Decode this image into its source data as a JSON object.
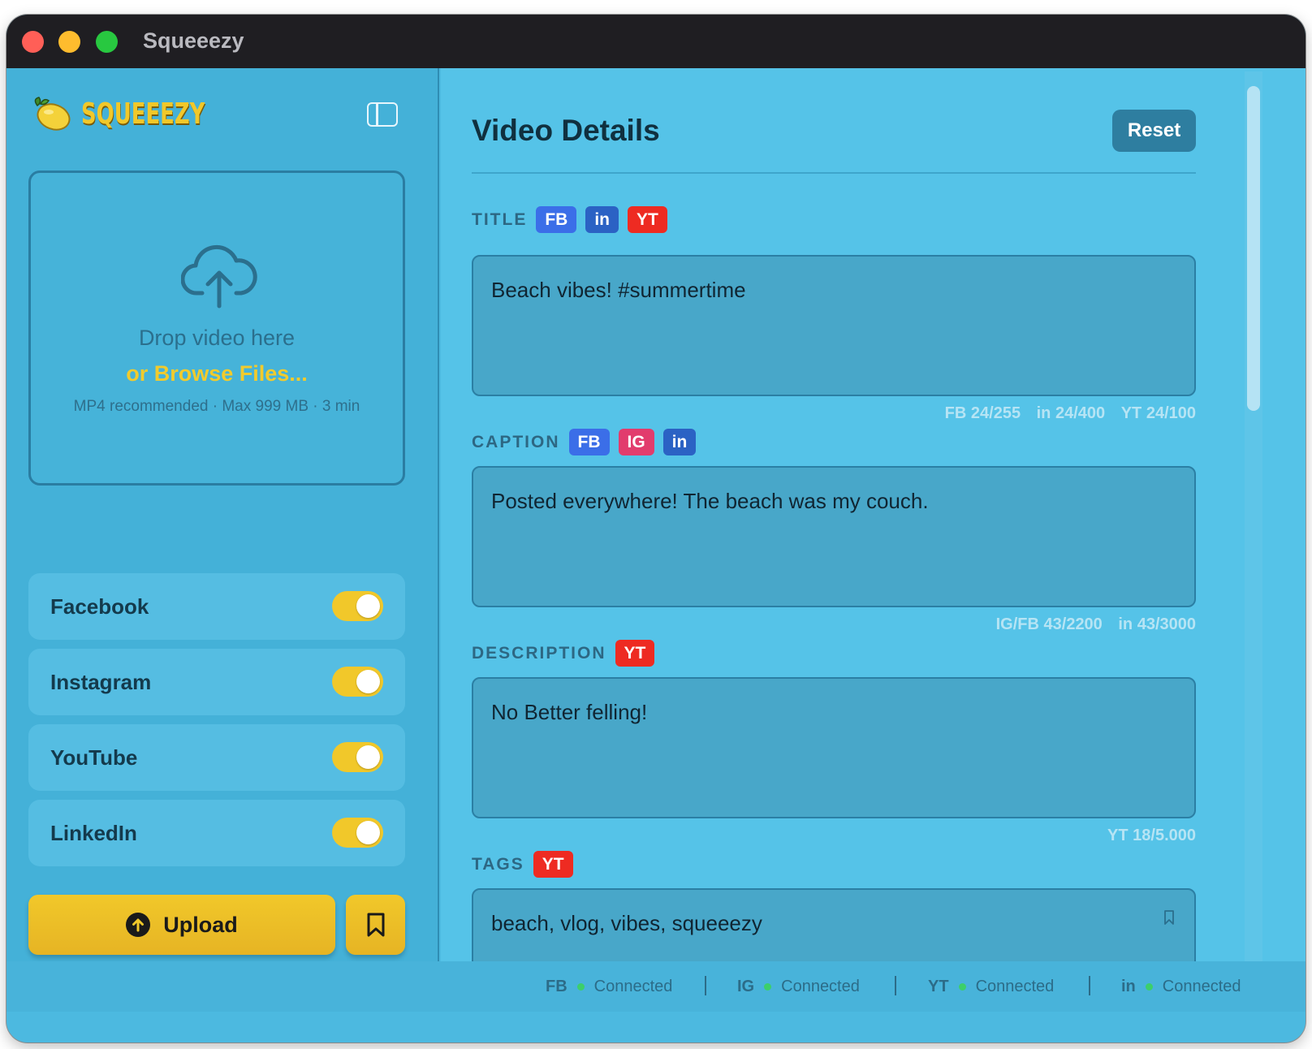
{
  "window": {
    "title": "Squeeezy"
  },
  "sidebar": {
    "logo_text": "SQUEEEZY",
    "dropzone": {
      "title": "Drop video here",
      "browse": "or Browse Files...",
      "hint": "MP4 recommended · Max 999 MB · 3 min"
    },
    "platforms": [
      {
        "label": "Facebook",
        "enabled": true
      },
      {
        "label": "Instagram",
        "enabled": true
      },
      {
        "label": "YouTube",
        "enabled": true
      },
      {
        "label": "LinkedIn",
        "enabled": true
      }
    ],
    "upload_label": "Upload"
  },
  "main": {
    "title": "Video Details",
    "reset_label": "Reset",
    "fields": {
      "title": {
        "label": "TITLE",
        "badges": [
          "FB",
          "in",
          "YT"
        ],
        "value": "Beach vibes! #summertime",
        "counters": [
          "FB 24/255",
          "in 24/400",
          "YT 24/100"
        ]
      },
      "caption": {
        "label": "CAPTION",
        "badges": [
          "FB",
          "IG",
          "in"
        ],
        "value": "Posted everywhere! The beach was my couch.",
        "counters": [
          "IG/FB 43/2200",
          "in 43/3000"
        ]
      },
      "description": {
        "label": "DESCRIPTION",
        "badges": [
          "YT"
        ],
        "value": "No Better felling!",
        "counters": [
          "YT 18/5.000"
        ]
      },
      "tags": {
        "label": "TAGS",
        "badges": [
          "YT"
        ],
        "value": "beach, vlog, vibes, squeeezy"
      }
    }
  },
  "status": [
    {
      "abbr": "FB",
      "text": "Connected"
    },
    {
      "abbr": "IG",
      "text": "Connected"
    },
    {
      "abbr": "YT",
      "text": "Connected"
    },
    {
      "abbr": "in",
      "text": "Connected"
    }
  ],
  "colors": {
    "accent_yellow": "#f1c82a",
    "facebook": "#3b6ee8",
    "linkedin": "#2b62c4",
    "youtube": "#ee2b22",
    "instagram": "#e23c6d",
    "connected": "#3ccf6a"
  }
}
